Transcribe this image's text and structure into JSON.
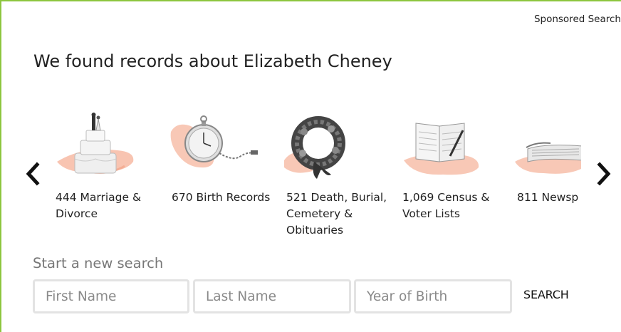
{
  "header": {
    "sponsored": "Sponsored Search",
    "headline": "We found records about Elizabeth Cheney"
  },
  "carousel": {
    "prev_icon": "chevron-left-icon",
    "next_icon": "chevron-right-icon",
    "items": [
      {
        "icon": "wedding-cake-icon",
        "label": "444 Marriage & Divorce"
      },
      {
        "icon": "pocket-watch-icon",
        "label": "670 Birth Records"
      },
      {
        "icon": "funeral-wreath-icon",
        "label": "521 Death, Burial, Cemetery & Obituaries"
      },
      {
        "icon": "census-ledger-icon",
        "label": "1,069 Census & Voter Lists"
      },
      {
        "icon": "newspaper-icon",
        "label": "811 Newsp"
      }
    ]
  },
  "search": {
    "label": "Start a new search",
    "first_name_placeholder": "First Name",
    "last_name_placeholder": "Last Name",
    "year_placeholder": "Year of Birth",
    "button": "SEARCH"
  },
  "colors": {
    "frame": "#8dc63f",
    "peach": "#f6b59e",
    "field_border": "#e3e3e3"
  }
}
